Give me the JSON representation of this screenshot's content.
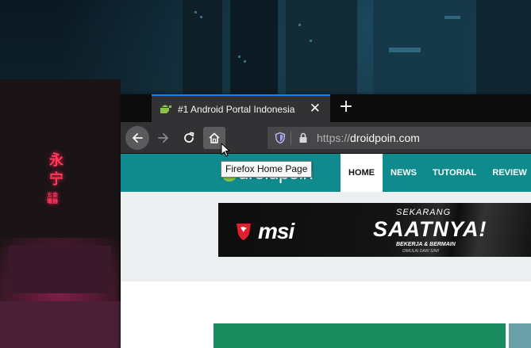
{
  "browser": {
    "tab": {
      "title": "#1 Android Portal Indonesia",
      "close_glyph": "✕",
      "favicon_icon": "android-icon"
    },
    "new_tab_glyph": "+",
    "nav": {
      "back_icon": "arrow-left-icon",
      "forward_icon": "arrow-right-icon",
      "reload_icon": "reload-icon",
      "home_icon": "home-icon"
    },
    "urlbar": {
      "scheme": "https://",
      "host": "droidpoin.com",
      "shield_icon": "tracking-protection-icon",
      "lock_icon": "lock-icon"
    },
    "tooltip": "Firefox Home Page"
  },
  "site": {
    "logo_text": "droidpoin",
    "menu": [
      {
        "label": "HOME",
        "active": true
      },
      {
        "label": "NEWS",
        "active": false
      },
      {
        "label": "TUTORIAL",
        "active": false
      },
      {
        "label": "REVIEW",
        "active": false
      }
    ],
    "ad": {
      "brand": "msi",
      "line1": "SEKARANG",
      "line2": "SAATNYA!",
      "line3": "BEKERJA & BERMAIN",
      "line4": "DIMULAI DARI SINI!"
    }
  },
  "wallpaper": {
    "sign_glyphs": [
      "永",
      "宁"
    ],
    "sign_small": "五金電器"
  },
  "colors": {
    "tab_accent": "#0a84ff",
    "site_header": "#0f8b8d",
    "msi_red": "#e41e2b",
    "favicon_green": "#8bc34a"
  }
}
